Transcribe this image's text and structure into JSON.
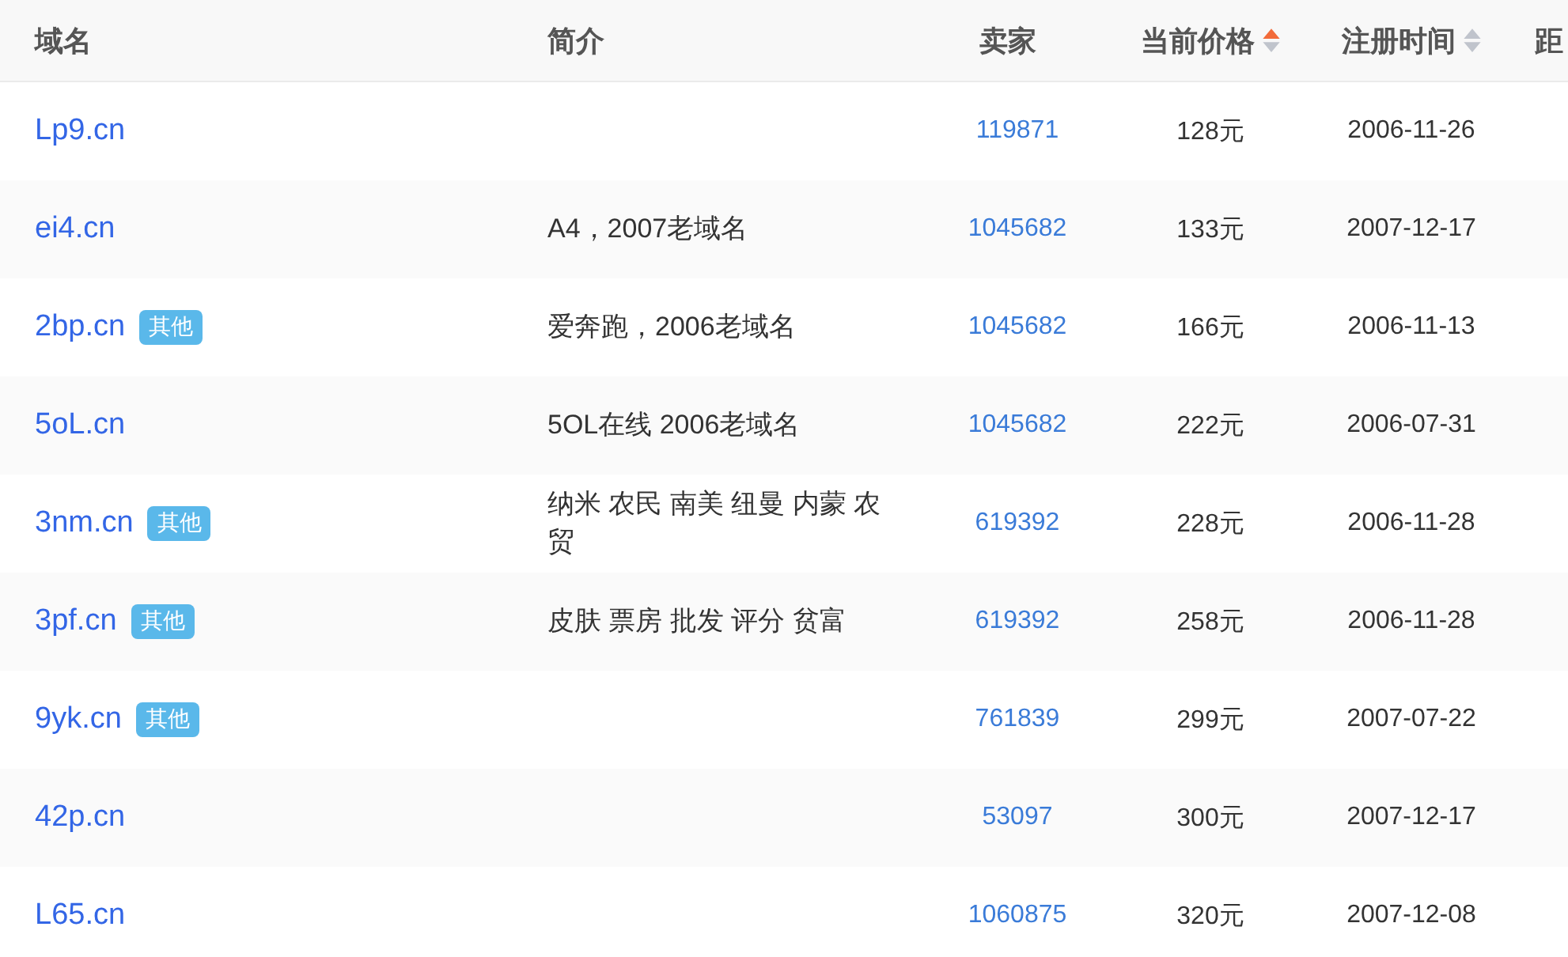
{
  "table": {
    "columns": [
      {
        "label": "域名"
      },
      {
        "label": "简介"
      },
      {
        "label": "卖家"
      },
      {
        "label": "当前价格",
        "sortable": true,
        "sorted": true
      },
      {
        "label": "注册时间",
        "sortable": true,
        "sorted": false
      },
      {
        "label": "距"
      }
    ],
    "rows": [
      {
        "domain": "Lp9.cn",
        "seller": "119871",
        "price": "128元",
        "date": "2006-11-26"
      },
      {
        "domain": "ei4.cn",
        "intro": "A4，2007老域名",
        "seller": "1045682",
        "price": "133元",
        "date": "2007-12-17"
      },
      {
        "domain": "2bp.cn",
        "tag": "其他",
        "intro": "爱奔跑，2006老域名",
        "seller": "1045682",
        "price": "166元",
        "date": "2006-11-13"
      },
      {
        "domain": "5oL.cn",
        "intro": "5OL在线 2006老域名",
        "seller": "1045682",
        "price": "222元",
        "date": "2006-07-31"
      },
      {
        "domain": "3nm.cn",
        "tag": "其他",
        "intro": "纳米 农民 南美 纽曼 内蒙 农贸",
        "seller": "619392",
        "price": "228元",
        "date": "2006-11-28"
      },
      {
        "domain": "3pf.cn",
        "tag": "其他",
        "intro": "皮肤 票房 批发 评分 贫富",
        "seller": "619392",
        "price": "258元",
        "date": "2006-11-28"
      },
      {
        "domain": "9yk.cn",
        "tag": "其他",
        "seller": "761839",
        "price": "299元",
        "date": "2007-07-22"
      },
      {
        "domain": "42p.cn",
        "seller": "53097",
        "price": "300元",
        "date": "2007-12-17"
      },
      {
        "domain": "L65.cn",
        "seller": "1060875",
        "price": "320元",
        "date": "2007-12-08"
      }
    ]
  }
}
